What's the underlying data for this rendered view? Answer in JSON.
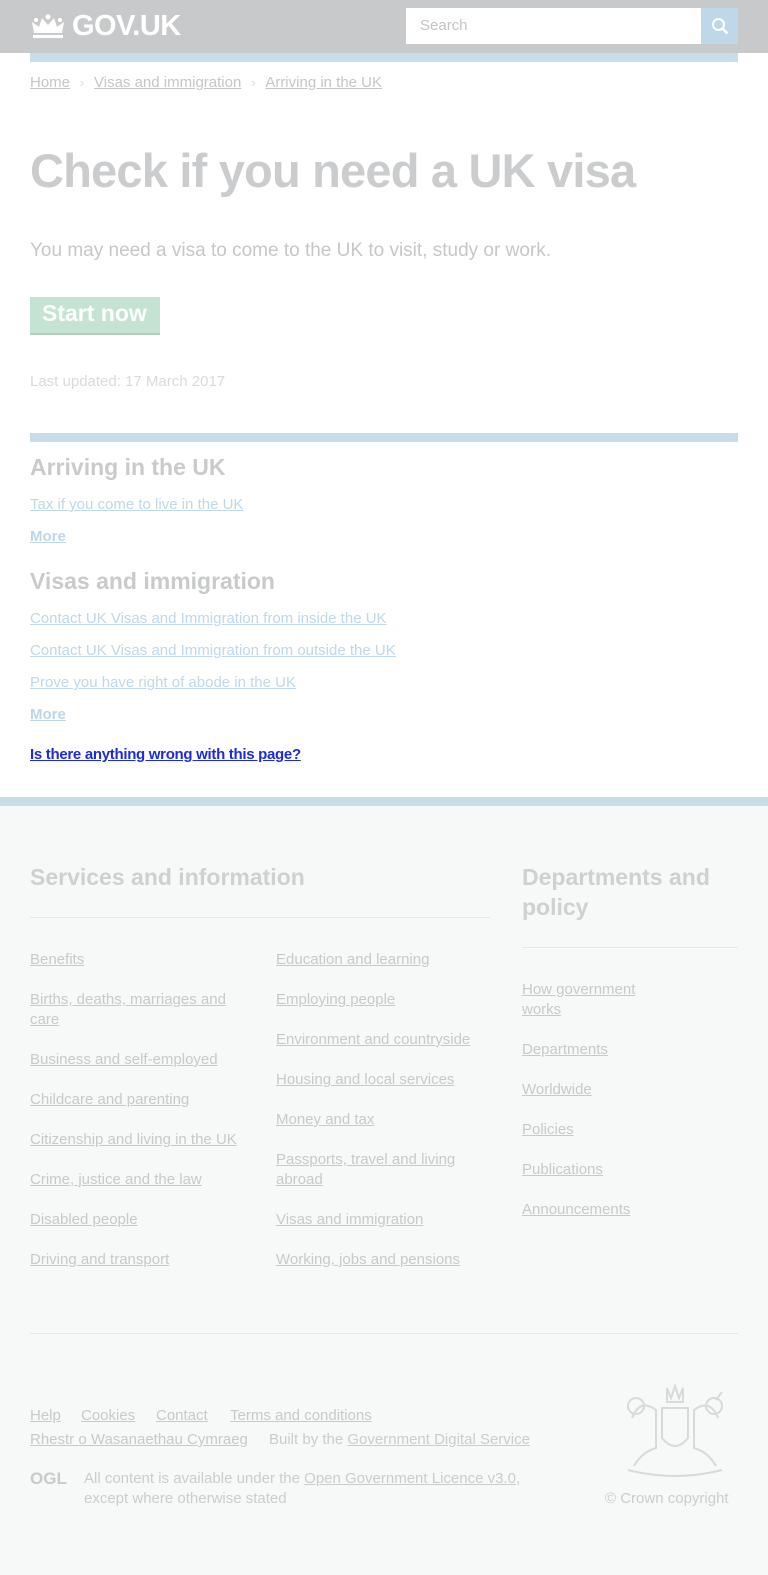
{
  "header": {
    "logo_text": "GOV.UK",
    "search_placeholder": "Search"
  },
  "breadcrumbs": [
    "Home",
    "Visas and immigration",
    "Arriving in the UK"
  ],
  "main": {
    "title": "Check if you need a UK visa",
    "lede": "You may need a visa to come to the UK to visit, study or work.",
    "start_button": "Start now",
    "last_updated": "Last updated: 17 March 2017"
  },
  "related": {
    "sections": [
      {
        "heading": "Arriving in the UK",
        "links": [
          "Tax if you come to live in the UK"
        ],
        "more": "More"
      },
      {
        "heading": "Visas and immigration",
        "links": [
          "Contact UK Visas and Immigration from inside the UK",
          "Contact UK Visas and Immigration from outside the UK",
          "Prove you have right of abode in the UK"
        ],
        "more": "More"
      }
    ]
  },
  "report_link": "Is there anything wrong with this page?",
  "footer": {
    "services_heading": "Services and information",
    "services_col1": [
      "Benefits",
      "Births, deaths, marriages and care",
      "Business and self-employed",
      "Childcare and parenting",
      "Citizenship and living in the UK",
      "Crime, justice and the law",
      "Disabled people",
      "Driving and transport"
    ],
    "services_col2": [
      "Education and learning",
      "Employing people",
      "Environment and countryside",
      "Housing and local services",
      "Money and tax",
      "Passports, travel and living abroad",
      "Visas and immigration",
      "Working, jobs and pensions"
    ],
    "departments_heading": "Departments and policy",
    "departments": [
      "How government works",
      "Departments",
      "Worldwide",
      "Policies",
      "Publications",
      "Announcements"
    ],
    "meta_links": [
      "Help",
      "Cookies",
      "Contact",
      "Terms and conditions"
    ],
    "welsh_link": "Rhestr o Wasanaethau Cymraeg",
    "built_by_prefix": "Built by the",
    "built_by_link": "Government Digital Service",
    "ogl_logo": "OGL",
    "licence_prefix": "All content is available under the",
    "licence_link": "Open Government Licence v3.0",
    "licence_suffix": ", except where otherwise stated",
    "copyright": "© Crown copyright"
  }
}
